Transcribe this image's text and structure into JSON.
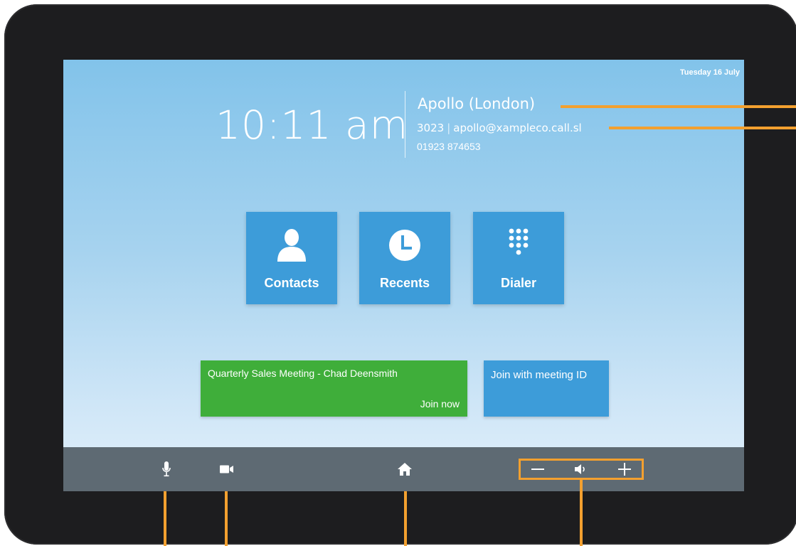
{
  "status": {
    "date": "Tuesday 16 July"
  },
  "clock": {
    "time": "10:11 am"
  },
  "room": {
    "name": "Apollo (London)",
    "extension": "3023",
    "separator": "|",
    "uri": "apollo@xampleco.call.sl",
    "phone": "01923 874653"
  },
  "tiles": [
    {
      "label": "Contacts",
      "icon": "person-icon"
    },
    {
      "label": "Recents",
      "icon": "clock-icon"
    },
    {
      "label": "Dialer",
      "icon": "keypad-icon"
    }
  ],
  "meeting": {
    "title": "Quarterly Sales Meeting - Chad Deensmith",
    "action": "Join now",
    "color": "#3fae3a"
  },
  "join_meeting_id": {
    "label": "Join with meeting ID"
  },
  "bottom_bar": {
    "items": [
      "microphone-icon",
      "camera-icon",
      "home-icon"
    ],
    "volume": [
      "volume-down-icon",
      "speaker-icon",
      "volume-up-icon"
    ]
  },
  "colors": {
    "accent": "#3d9cd9",
    "callout": "#f3a02f",
    "bar": "#5e6a73"
  }
}
